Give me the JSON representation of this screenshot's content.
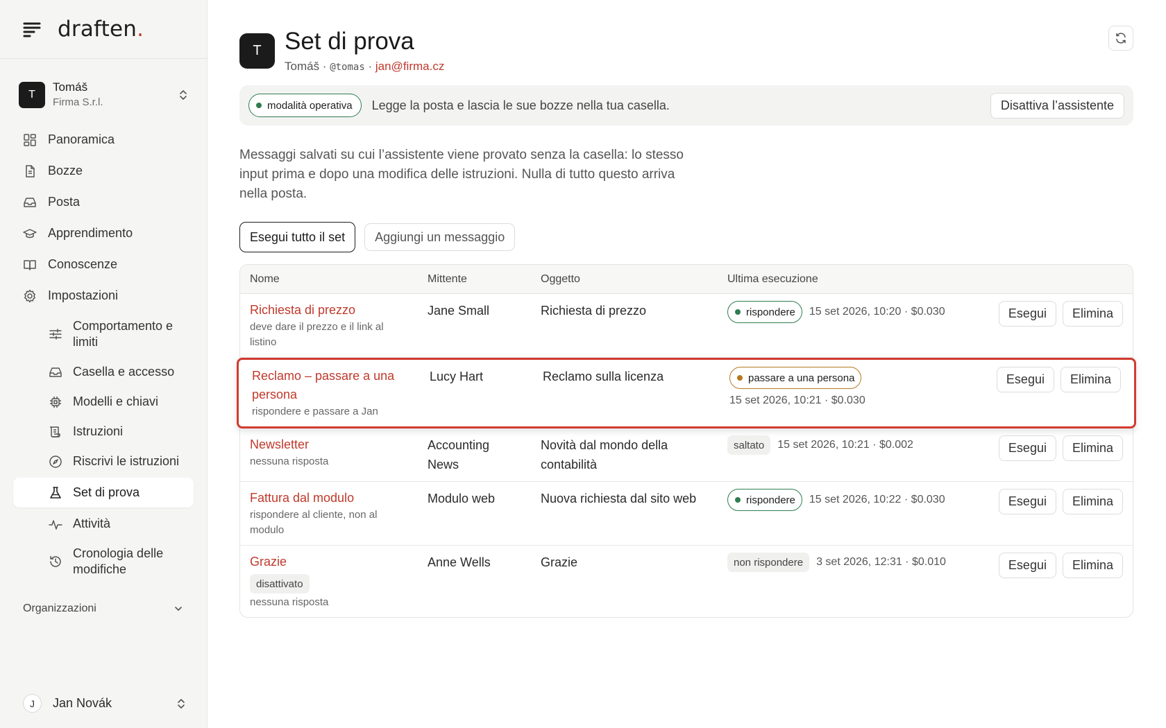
{
  "brand": {
    "name": "draften",
    "dot": "."
  },
  "account": {
    "initial": "T",
    "name": "Tomáš",
    "org": "Firma S.r.l."
  },
  "nav": {
    "overview": "Panoramica",
    "drafts": "Bozze",
    "mail": "Posta",
    "learning": "Apprendimento",
    "knowledge": "Conoscenze",
    "settings": "Impostazioni"
  },
  "subnav": {
    "behavior": "Comportamento e limiti",
    "mailbox": "Casella e accesso",
    "models": "Modelli e chiavi",
    "instructions": "Istruzioni",
    "rewrite": "Riscrivi le istruzioni",
    "testset": "Set di prova",
    "activity": "Attività",
    "history": "Cronologia delle modifiche"
  },
  "organizations_label": "Organizzazioni",
  "user": {
    "initial": "J",
    "name": "Jan Novák"
  },
  "header": {
    "initial": "T",
    "title": "Set di prova",
    "name": "Tomáš",
    "handle": "@tomas",
    "email": "jan@firma.cz"
  },
  "mode": {
    "pill": "modalità operativa",
    "text": "Legge la posta e lascia le sue bozze nella tua casella.",
    "deactivate": "Disattiva l’assistente"
  },
  "description": "Messaggi salvati su cui l’assistente viene provato senza la casella: lo stesso input prima e dopo una modifica delle istruzioni. Nulla di tutto questo arriva nella posta.",
  "actions": {
    "run_all": "Esegui tutto il set",
    "add": "Aggiungi un messaggio"
  },
  "table": {
    "headers": {
      "name": "Nome",
      "sender": "Mittente",
      "subject": "Oggetto",
      "last_run": "Ultima esecuzione"
    },
    "run_label": "Esegui",
    "delete_label": "Elimina",
    "rows": [
      {
        "name": "Richiesta di prezzo",
        "note": "deve dare il prezzo e il link al listino",
        "tag": "",
        "sender": "Jane Small",
        "subject": "Richiesta di prezzo",
        "result": "rispondere",
        "meta": "15 set 2026, 10:20 · $0.030"
      },
      {
        "name": "Reclamo – passare a una persona",
        "note": "rispondere e passare a Jan",
        "tag": "",
        "sender": "Lucy Hart",
        "subject": "Reclamo sulla licenza",
        "result": "passare a una persona",
        "meta": "15 set 2026, 10:21 · $0.030"
      },
      {
        "name": "Newsletter",
        "note": "nessuna risposta",
        "tag": "",
        "sender": "Accounting News",
        "subject": "Novità dal mondo della contabilità",
        "result": "saltato",
        "meta": "15 set 2026, 10:21 · $0.002"
      },
      {
        "name": "Fattura dal modulo",
        "note": "rispondere al cliente, non al modulo",
        "tag": "",
        "sender": "Modulo web",
        "subject": "Nuova richiesta dal sito web",
        "result": "rispondere",
        "meta": "15 set 2026, 10:22 · $0.030"
      },
      {
        "name": "Grazie",
        "note": "nessuna risposta",
        "tag": "disattivato",
        "sender": "Anne Wells",
        "subject": "Grazie",
        "result": "non rispondere",
        "meta": "3 set 2026, 12:31 · $0.010"
      }
    ]
  },
  "colors": {
    "accent": "#c0392b",
    "green": "#2e7d4f",
    "amber": "#b7791f",
    "highlight": "#d13b2f"
  }
}
